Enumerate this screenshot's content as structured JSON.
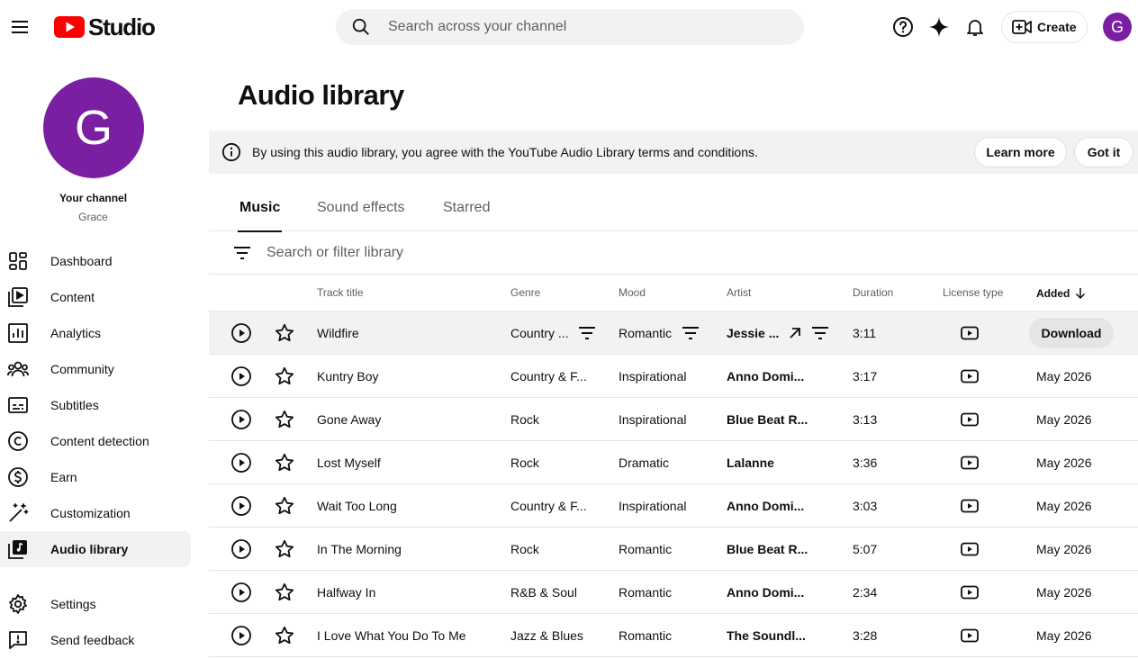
{
  "header": {
    "logo_text": "Studio",
    "search_placeholder": "Search across your channel",
    "create_label": "Create",
    "avatar_letter": "G"
  },
  "sidebar": {
    "avatar_letter": "G",
    "channel_title": "Your channel",
    "channel_name": "Grace",
    "items": [
      {
        "label": "Dashboard",
        "icon": "dashboard-icon"
      },
      {
        "label": "Content",
        "icon": "content-icon"
      },
      {
        "label": "Analytics",
        "icon": "analytics-icon"
      },
      {
        "label": "Community",
        "icon": "community-icon"
      },
      {
        "label": "Subtitles",
        "icon": "subtitles-icon"
      },
      {
        "label": "Content detection",
        "icon": "copyright-icon"
      },
      {
        "label": "Earn",
        "icon": "dollar-icon"
      },
      {
        "label": "Customization",
        "icon": "magic-wand-icon"
      },
      {
        "label": "Audio library",
        "icon": "audio-library-icon",
        "active": true
      }
    ],
    "bottom_items": [
      {
        "label": "Settings",
        "icon": "gear-icon"
      },
      {
        "label": "Send feedback",
        "icon": "feedback-icon"
      }
    ]
  },
  "main": {
    "title": "Audio library",
    "banner": {
      "text": "By using this audio library, you agree with the YouTube Audio Library terms and conditions.",
      "learn_more": "Learn more",
      "got_it": "Got it"
    },
    "tabs": [
      "Music",
      "Sound effects",
      "Starred"
    ],
    "active_tab": "Music",
    "filter_placeholder": "Search or filter library",
    "columns": {
      "title": "Track title",
      "genre": "Genre",
      "mood": "Mood",
      "artist": "Artist",
      "duration": "Duration",
      "license": "License type",
      "added": "Added"
    },
    "download_label": "Download",
    "tracks": [
      {
        "title": "Wildfire",
        "genre": "Country ...",
        "mood": "Romantic",
        "artist": "Jessie ...",
        "duration": "3:11",
        "added": "",
        "hover": true
      },
      {
        "title": "Kuntry Boy",
        "genre": "Country & F...",
        "mood": "Inspirational",
        "artist": "Anno Domi...",
        "duration": "3:17",
        "added": "May 2026"
      },
      {
        "title": "Gone Away",
        "genre": "Rock",
        "mood": "Inspirational",
        "artist": "Blue Beat R...",
        "duration": "3:13",
        "added": "May 2026"
      },
      {
        "title": "Lost Myself",
        "genre": "Rock",
        "mood": "Dramatic",
        "artist": "Lalanne",
        "duration": "3:36",
        "added": "May 2026"
      },
      {
        "title": "Wait Too Long",
        "genre": "Country & F...",
        "mood": "Inspirational",
        "artist": "Anno Domi...",
        "duration": "3:03",
        "added": "May 2026"
      },
      {
        "title": "In The Morning",
        "genre": "Rock",
        "mood": "Romantic",
        "artist": "Blue Beat R...",
        "duration": "5:07",
        "added": "May 2026"
      },
      {
        "title": "Halfway In",
        "genre": "R&B & Soul",
        "mood": "Romantic",
        "artist": "Anno Domi...",
        "duration": "2:34",
        "added": "May 2026"
      },
      {
        "title": "I Love What You Do To Me",
        "genre": "Jazz & Blues",
        "mood": "Romantic",
        "artist": "The Soundl...",
        "duration": "3:28",
        "added": "May 2026"
      }
    ]
  },
  "colors": {
    "brand_red": "#ff0000",
    "avatar_purple": "#7b1fa2",
    "hover_bg": "#f2f2f2"
  }
}
